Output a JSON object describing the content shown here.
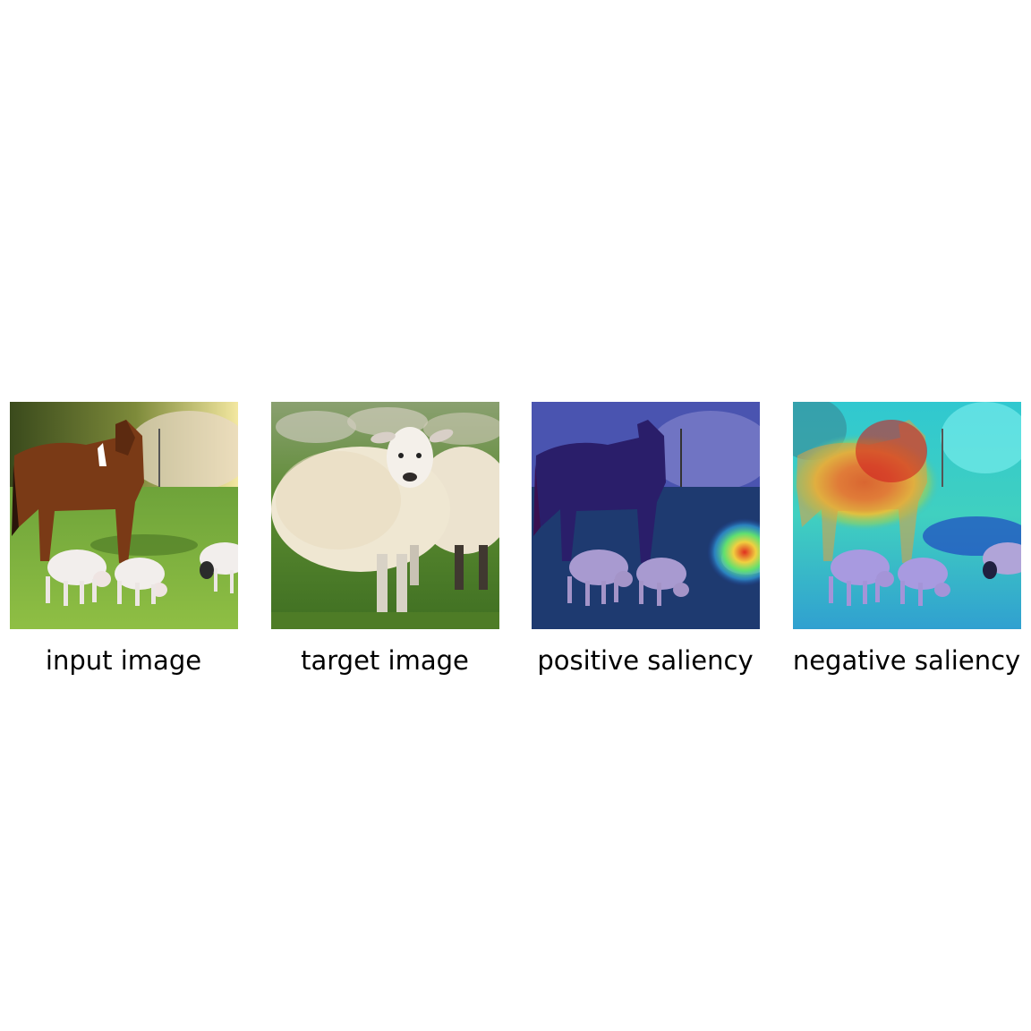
{
  "panels": [
    {
      "caption": "input image"
    },
    {
      "caption": "target image"
    },
    {
      "caption": "positive saliency"
    },
    {
      "caption": "negative saliency"
    }
  ]
}
